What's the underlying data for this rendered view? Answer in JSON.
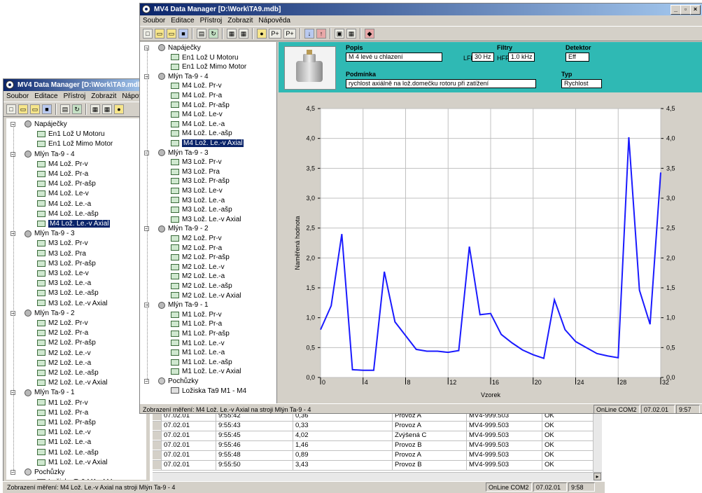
{
  "back_window": {
    "title": "MV4 Data Manager [D:\\Work\\TA9.mdb]",
    "menu": [
      "Soubor",
      "Editace",
      "Přístroj",
      "Zobrazit",
      "Nápově"
    ],
    "status_text": "Zobrazení měření:  M4 Lož. Le.-v Axial  na stroji  Mlýn Ta-9 - 4",
    "status_online": "OnLine COM2",
    "status_date": "07.02.01",
    "status_time": "9:58"
  },
  "front_window": {
    "title": "MV4 Data Manager [D:\\Work\\TA9.mdb]",
    "menu": [
      "Soubor",
      "Editace",
      "Přístroj",
      "Zobrazit",
      "Nápověda"
    ],
    "status_text": "Zobrazení měření:  M4 Lož. Le.-v Axial  na stroji  Mlýn Ta-9 - 4",
    "status_online": "OnLine COM2",
    "status_date": "07.02.01",
    "status_time": "9:57"
  },
  "tree": [
    {
      "type": "group",
      "label": "Napáječky"
    },
    {
      "type": "meas",
      "label": "En1 Lož U Motoru"
    },
    {
      "type": "meas",
      "label": "En1 Lož Mimo Motor"
    },
    {
      "type": "group",
      "label": "Mlýn Ta-9 - 4"
    },
    {
      "type": "meas",
      "label": "M4 Lož. Pr-v"
    },
    {
      "type": "meas",
      "label": "M4 Lož. Pr-a"
    },
    {
      "type": "meas",
      "label": "M4 Lož. Pr-ašp"
    },
    {
      "type": "meas",
      "label": "M4 Lož. Le-v"
    },
    {
      "type": "meas",
      "label": "M4 Lož. Le.-a"
    },
    {
      "type": "meas",
      "label": "M4 Lož. Le.-ašp"
    },
    {
      "type": "meas",
      "label": "M4 Lož. Le.-v Axial",
      "selected": true
    },
    {
      "type": "group",
      "label": "Mlýn Ta-9 - 3"
    },
    {
      "type": "meas",
      "label": "M3 Lož. Pr-v"
    },
    {
      "type": "meas",
      "label": "M3 Lož. Pra"
    },
    {
      "type": "meas",
      "label": "M3 Lož. Pr-ašp"
    },
    {
      "type": "meas",
      "label": "M3 Lož. Le-v"
    },
    {
      "type": "meas",
      "label": "M3 Lož. Le.-a"
    },
    {
      "type": "meas",
      "label": "M3 Lož. Le.-ašp"
    },
    {
      "type": "meas",
      "label": "M3 Lož. Le.-v Axial"
    },
    {
      "type": "group",
      "label": "Mlýn Ta-9 - 2"
    },
    {
      "type": "meas",
      "label": "M2 Lož. Pr-v"
    },
    {
      "type": "meas",
      "label": "M2 Lož. Pr-a"
    },
    {
      "type": "meas",
      "label": "M2 Lož. Pr-ašp"
    },
    {
      "type": "meas",
      "label": "M2 Lož. Le.-v"
    },
    {
      "type": "meas",
      "label": "M2 Lož. Le.-a"
    },
    {
      "type": "meas",
      "label": "M2 Lož. Le.-ašp"
    },
    {
      "type": "meas",
      "label": "M2 Lož. Le.-v Axial"
    },
    {
      "type": "group",
      "label": "Mlýn Ta-9 - 1"
    },
    {
      "type": "meas",
      "label": "M1 Lož. Pr-v"
    },
    {
      "type": "meas",
      "label": "M1 Lož. Pr-a"
    },
    {
      "type": "meas",
      "label": "M1 Lož. Pr-ašp"
    },
    {
      "type": "meas",
      "label": "M1 Lož. Le.-v"
    },
    {
      "type": "meas",
      "label": "M1 Lož. Le.-a"
    },
    {
      "type": "meas",
      "label": "M1 Lož. Le.-ašp"
    },
    {
      "type": "meas",
      "label": "M1 Lož. Le.-v Axial"
    },
    {
      "type": "route",
      "label": "Pochůzky"
    },
    {
      "type": "table",
      "label": "Ložiska Ta9  M1 - M4"
    }
  ],
  "header": {
    "popis_label": "Popis",
    "popis_value": "M 4 levé u chlazení",
    "filtry_label": "Filtry",
    "lff_label": "LFF",
    "lff_value": "30 Hz",
    "hff_label": "HFF",
    "hff_value": "1.0 kHz",
    "detektor_label": "Detektor",
    "detektor_value": "Eff",
    "podminka_label": "Podmínka",
    "podminka_value": "rychlost axiálně na lož.domečku rotoru při zatížení",
    "typ_label": "Typ",
    "typ_value": "Rychlost"
  },
  "chart_data": {
    "type": "line",
    "ylabel": "Naměřená hodnota",
    "xlabel": "Vzorek",
    "xlim": [
      0,
      32
    ],
    "ylim": [
      0,
      4.5
    ],
    "x_ticks": [
      0,
      4,
      8,
      12,
      16,
      20,
      24,
      28,
      32
    ],
    "y_ticks": [
      "0,0",
      "0,5",
      "1,0",
      "1,5",
      "2,0",
      "2,5",
      "3,0",
      "3,5",
      "4,0",
      "4,5"
    ],
    "grid": true,
    "series_color": "#1a1aff",
    "x": [
      0,
      1,
      2,
      3,
      4,
      5,
      6,
      7,
      8,
      9,
      10,
      11,
      12,
      13,
      14,
      15,
      16,
      17,
      18,
      19,
      20,
      21,
      22,
      23,
      24,
      25,
      26,
      27,
      28,
      29,
      30,
      31,
      32
    ],
    "y": [
      0.8,
      1.2,
      2.4,
      0.13,
      0.12,
      0.12,
      1.77,
      0.93,
      0.7,
      0.47,
      0.44,
      0.44,
      0.42,
      0.45,
      2.19,
      1.05,
      1.07,
      0.72,
      0.58,
      0.46,
      0.38,
      0.32,
      1.3,
      0.8,
      0.6,
      0.5,
      0.4,
      0.36,
      0.33,
      4.02,
      1.46,
      0.89,
      3.43
    ]
  },
  "table": {
    "rows": [
      [
        "07.02.01",
        "9:55:42",
        "0,36",
        "Provoz A",
        "MV4-999.503",
        "OK"
      ],
      [
        "07.02.01",
        "9:55:43",
        "0,33",
        "Provoz A",
        "MV4-999.503",
        "OK"
      ],
      [
        "07.02.01",
        "9:55:45",
        "4,02",
        "Zvýšená C",
        "MV4-999.503",
        "OK"
      ],
      [
        "07.02.01",
        "9:55:46",
        "1,46",
        "Provoz B",
        "MV4-999.503",
        "OK"
      ],
      [
        "07.02.01",
        "9:55:48",
        "0,89",
        "Provoz A",
        "MV4-999.503",
        "OK"
      ],
      [
        "07.02.01",
        "9:55:50",
        "3,43",
        "Provoz B",
        "MV4-999.503",
        "OK"
      ]
    ]
  }
}
